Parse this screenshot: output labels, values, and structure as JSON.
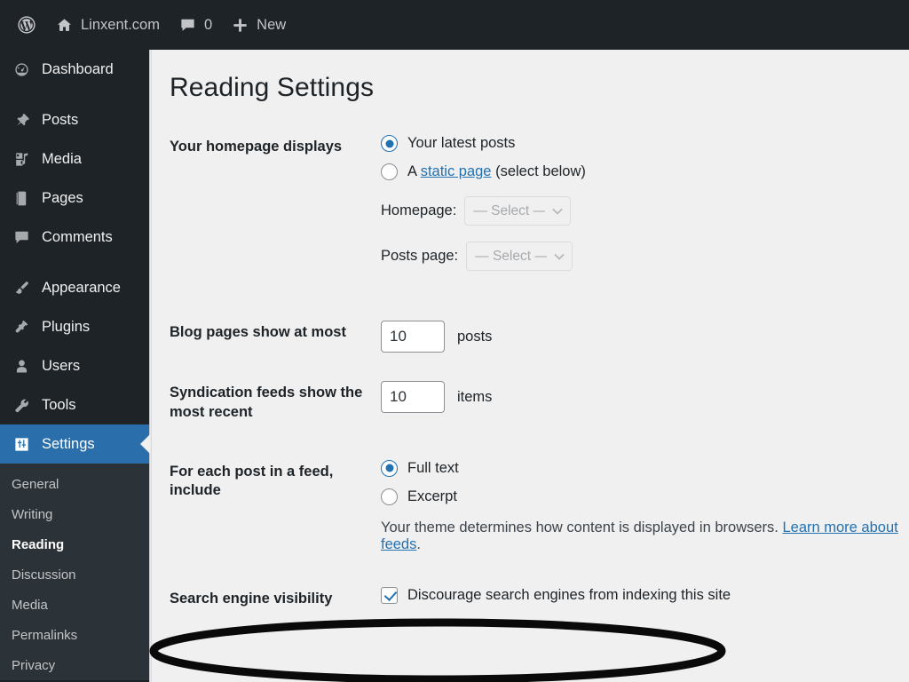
{
  "adminbar": {
    "wp_logo": "wordpress-logo-icon",
    "site_name": "Linxent.com",
    "home_icon": "home-icon",
    "comments_icon": "comment-bubble-icon",
    "comments_count": "0",
    "new_icon": "plus-icon",
    "new_label": "New"
  },
  "sidebar": {
    "items": [
      {
        "label": "Dashboard",
        "icon": "dashboard-icon",
        "current": false,
        "spaced": false
      },
      {
        "label": "Posts",
        "icon": "pin-icon",
        "current": false,
        "spaced": true
      },
      {
        "label": "Media",
        "icon": "media-icon",
        "current": false,
        "spaced": false
      },
      {
        "label": "Pages",
        "icon": "page-icon",
        "current": false,
        "spaced": false
      },
      {
        "label": "Comments",
        "icon": "comment-bubble-icon",
        "current": false,
        "spaced": false
      },
      {
        "label": "Appearance",
        "icon": "paintbrush-icon",
        "current": false,
        "spaced": true
      },
      {
        "label": "Plugins",
        "icon": "plug-icon",
        "current": false,
        "spaced": false
      },
      {
        "label": "Users",
        "icon": "user-icon",
        "current": false,
        "spaced": false
      },
      {
        "label": "Tools",
        "icon": "wrench-icon",
        "current": false,
        "spaced": false
      },
      {
        "label": "Settings",
        "icon": "settings-sliders-icon",
        "current": true,
        "spaced": false
      }
    ],
    "submenu": [
      {
        "label": "General",
        "current": false
      },
      {
        "label": "Writing",
        "current": false
      },
      {
        "label": "Reading",
        "current": true
      },
      {
        "label": "Discussion",
        "current": false
      },
      {
        "label": "Media",
        "current": false
      },
      {
        "label": "Permalinks",
        "current": false
      },
      {
        "label": "Privacy",
        "current": false
      }
    ]
  },
  "page": {
    "title": "Reading Settings"
  },
  "homepage_displays": {
    "label": "Your homepage displays",
    "options": [
      {
        "text": "Your latest posts",
        "checked": true
      },
      {
        "text_before": "A ",
        "link": "static page",
        "text_after": " (select below)",
        "checked": false
      }
    ],
    "homepage_select": {
      "label": "Homepage:",
      "value": "— Select —",
      "options": [
        "— Select —"
      ]
    },
    "posts_page_select": {
      "label": "Posts page:",
      "value": "— Select —",
      "options": [
        "— Select —"
      ]
    }
  },
  "blog_pages": {
    "label": "Blog pages show at most",
    "value": "10",
    "suffix": "posts"
  },
  "syndication_feeds": {
    "label": "Syndication feeds show the most recent",
    "value": "10",
    "suffix": "items"
  },
  "feed_include": {
    "label": "For each post in a feed, include",
    "options": [
      {
        "text": "Full text",
        "checked": true
      },
      {
        "text": "Excerpt",
        "checked": false
      }
    ],
    "note_text": "Your theme determines how content is displayed in browsers. ",
    "note_link": "Learn more about feeds",
    "note_suffix": "."
  },
  "search_visibility": {
    "label": "Search engine visibility",
    "checkbox_label": "Discourage search engines from indexing this site",
    "checked": true
  },
  "annotation": {
    "type": "hand-drawn-ellipse-highlight",
    "color": "#000000"
  },
  "colors": {
    "admin_dark": "#1d2327",
    "submenu_dark": "#2c3338",
    "accent_blue": "#2271b1",
    "current_menu_blue": "#2a6fab",
    "content_bg": "#f0f0f1"
  }
}
